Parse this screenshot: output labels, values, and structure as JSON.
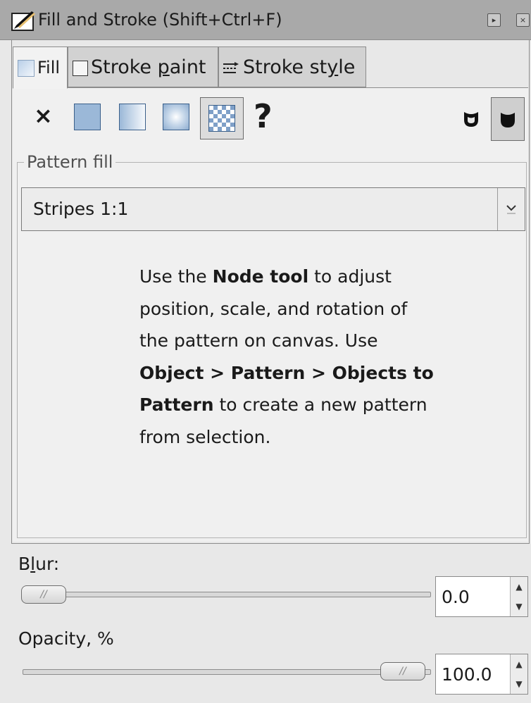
{
  "window": {
    "title": "Fill and Stroke (Shift+Ctrl+F)"
  },
  "tabs": [
    {
      "label": "Fill"
    },
    {
      "label_pre": "Stroke ",
      "label_u": "p",
      "label_post": "aint"
    },
    {
      "label_pre": "Stroke st",
      "label_u": "y",
      "label_post": "le"
    }
  ],
  "paint": {
    "none_glyph": "×",
    "unset_glyph": "?",
    "selected_mode": "pattern"
  },
  "pattern_fill": {
    "group_label": "Pattern fill",
    "selected": "Stripes 1:1",
    "hint_1": "Use the ",
    "hint_b1": "Node tool",
    "hint_2": " to adjust position, scale, and rotation of the pattern on canvas. Use ",
    "hint_b2": "Object > Pattern > Objects to Pattern",
    "hint_3": " to create a new pattern from selection."
  },
  "blur": {
    "label_pre": "B",
    "label_u": "l",
    "label_post": "ur:",
    "value": "0.0",
    "level": 0.0
  },
  "opacity": {
    "label": "Opacity, %",
    "value": "100.0",
    "level": 1.0
  },
  "colors": {
    "accent": "#9bb8d8",
    "border": "#8c8c8c",
    "titlebar": "#a9a9a9"
  }
}
